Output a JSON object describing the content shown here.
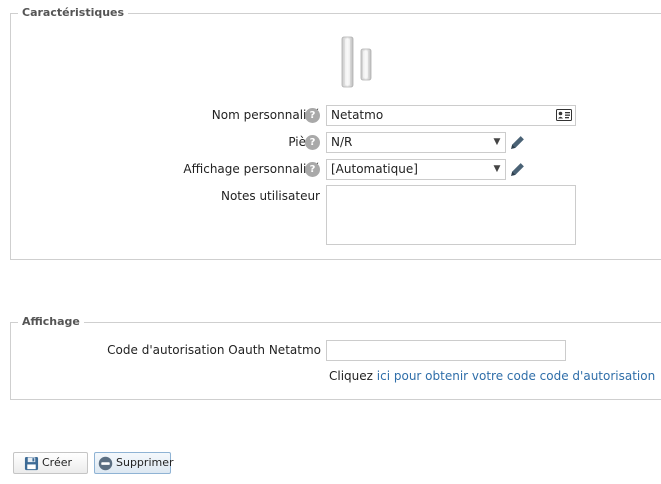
{
  "caracteristiques": {
    "legend": "Caractéristiques",
    "device_image_icon": "netatmo-device-icon",
    "nom_label": "Nom personnalisé",
    "nom_value": "Netatmo",
    "piece_label": "Pièce",
    "piece_value": "N/R",
    "affichage_label": "Affichage personnalisé",
    "affichage_value": "[Automatique]",
    "notes_label": "Notes utilisateur",
    "notes_value": "",
    "help_glyph": "?"
  },
  "affichage": {
    "legend": "Affichage",
    "code_label": "Code d'autorisation Oauth Netatmo",
    "code_value": "",
    "hint_prefix": "Cliquez",
    "hint_link": "ici pour obtenir votre code code d'autorisation"
  },
  "buttons": {
    "create_label": "Créer",
    "delete_label": "Supprimer"
  },
  "colors": {
    "link": "#2f6ea9",
    "help_icon": "#a9a9a9",
    "pencil": "#4a6275"
  }
}
